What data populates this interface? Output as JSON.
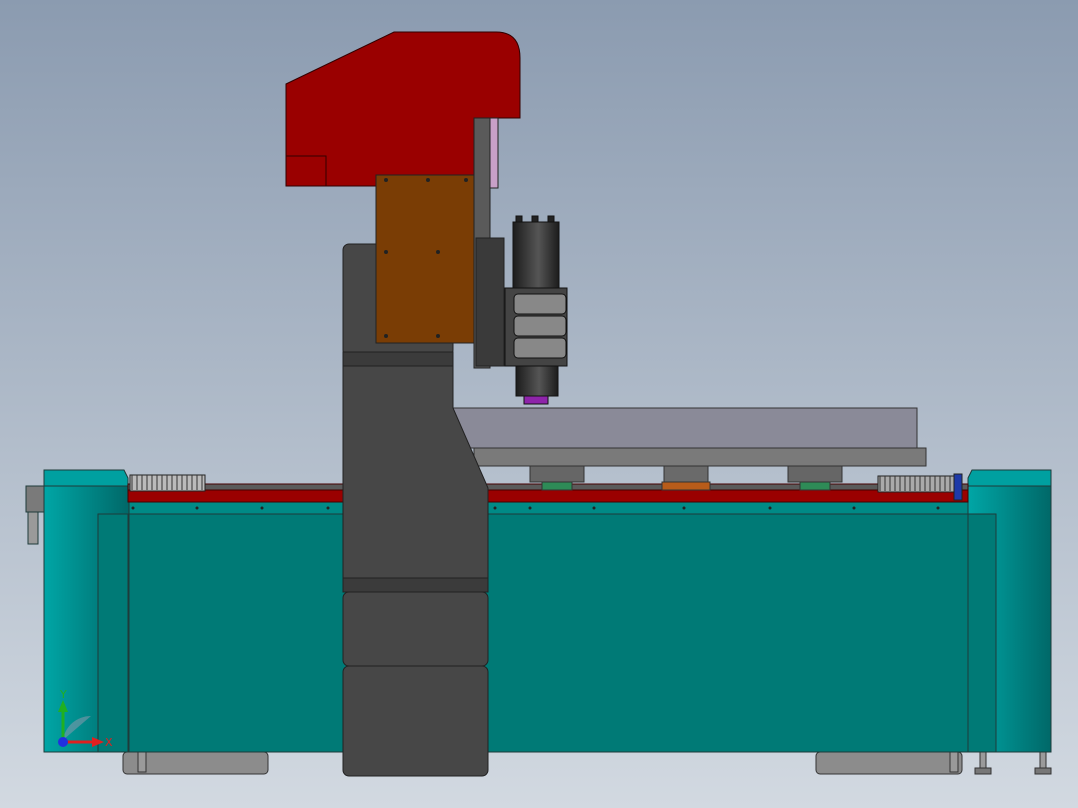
{
  "viewport": {
    "background_top": "#8b9bb0",
    "background_bottom": "#d2d9e1"
  },
  "colors": {
    "base_teal": "#007a76",
    "base_teal_light": "#00a0a0",
    "frame_red": "#9a0000",
    "gantry_gray": "#474747",
    "bracket_brown": "#7a3d05",
    "table_gray": "#8a8a98",
    "spindle_dark": "#2a2a2a",
    "tool_purple": "#8e24aa",
    "guide_green": "#2e8b57",
    "feet_gray": "#8c8c8c",
    "axis_x": "#e02020",
    "axis_y": "#20b020",
    "axis_z": "#2030e0"
  },
  "triad": {
    "x_label": "X",
    "y_label": "Y"
  }
}
